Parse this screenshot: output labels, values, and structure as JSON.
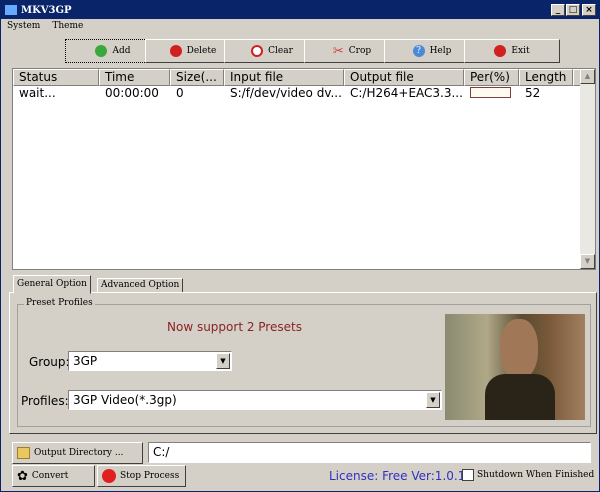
{
  "window": {
    "title": "MKV3GP",
    "minimize": "_",
    "maximize": "□",
    "close": "×"
  },
  "menu": [
    "System",
    "Theme"
  ],
  "toolbar": [
    {
      "label": "Add",
      "icon": "add-icon",
      "color": "#3aa83a"
    },
    {
      "label": "Delete",
      "icon": "delete-icon",
      "color": "#d02020"
    },
    {
      "label": "Clear",
      "icon": "clear-icon",
      "color": "#d02020"
    },
    {
      "label": "Crop",
      "icon": "scissors-icon",
      "color": "#d04040"
    },
    {
      "label": "Help",
      "icon": "help-icon",
      "color": "#4a8ad8"
    },
    {
      "label": "Exit",
      "icon": "exit-icon",
      "color": "#d02020"
    }
  ],
  "table": {
    "columns": [
      "Status",
      "Time",
      "Size(...",
      "Input file",
      "Output file",
      "Per(%)",
      "Length"
    ],
    "rows": [
      {
        "status": "wait...",
        "time": "00:00:00",
        "size": "0",
        "input": "S:/f/dev/video dv...",
        "output": "C:/H264+EAC3.3...",
        "per": 0,
        "length": "52"
      }
    ]
  },
  "tabs": [
    "General Option",
    "Advanced Option"
  ],
  "preset": {
    "legend": "Preset Profiles",
    "notice": "Now support 2 Presets",
    "group_label": "Group:",
    "group_value": "3GP",
    "profiles_label": "Profiles:",
    "profiles_value": "3GP Video(*.3gp)"
  },
  "bottom": {
    "output_dir_button": "Output Directory ...",
    "output_dir_value": "C:/",
    "convert": "Convert",
    "stop": "Stop Process",
    "license": "License: Free Ver:1.0.1",
    "shutdown": "Shutdown When Finished"
  }
}
